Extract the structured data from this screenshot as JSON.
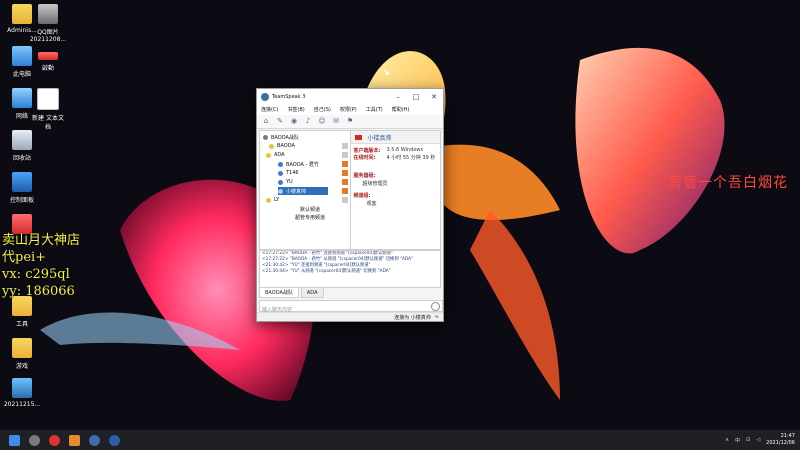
{
  "desktop": {
    "icons": [
      {
        "label": "Adminis...",
        "kind": "folder"
      },
      {
        "label": "QQ图片\n20211208...",
        "kind": "img"
      },
      {
        "label": "此电脑",
        "kind": "pc"
      },
      {
        "label": "啟動",
        "kind": "app"
      },
      {
        "label": "网络",
        "kind": "net"
      },
      {
        "label": "新建 文本文\n档",
        "kind": "doc"
      },
      {
        "label": "回收站",
        "kind": "bin"
      },
      {
        "label": "控制面板",
        "kind": "ctrl"
      },
      {
        "label": "工具",
        "kind": "folder"
      },
      {
        "label": "游戏",
        "kind": "folder"
      },
      {
        "label": "20211215...",
        "kind": "phone"
      }
    ],
    "overlay_lines": [
      "卖山月大神店",
      "代pei+",
      "vx: c295ql",
      "yy: 186066"
    ],
    "side_text": "房管一个吾白烟花"
  },
  "teamspeak": {
    "title": "TeamSpeak 3",
    "menu": [
      "连接(C)",
      "书签(B)",
      "自己(S)",
      "权限(P)",
      "工具(T)",
      "帮助(H)"
    ],
    "tree": {
      "server": "BAODA战队",
      "items": [
        {
          "label": "BAODA",
          "level": 1
        },
        {
          "label": "ADA",
          "level": 1
        },
        {
          "label": "BAODA - 君竹",
          "level": 2
        },
        {
          "label": "T146",
          "level": 2
        },
        {
          "label": "YU",
          "level": 2
        },
        {
          "label": "小楼真帅",
          "level": 2,
          "selected": true
        },
        {
          "label": "LY",
          "level": 1
        },
        {
          "label": "默认频道",
          "level": 2
        },
        {
          "label": "超管专用频道",
          "level": 2
        }
      ]
    },
    "info": {
      "username": "小楼真帅",
      "client_version_label": "客户端版本:",
      "client_version": "3.5.6 Windows",
      "online_label": "在线时间:",
      "online": "4 小时 55 分钟 39 秒",
      "server_group_label": "服务器组:",
      "server_group": "超级管理员",
      "channel_group_label": "频道组:",
      "channel_group": "观客"
    },
    "chat_log": [
      "<17:27:22> \"BAODA - 君竹\" 连接到频道 \"[cspacer04]默认频道\"",
      "<17:27:22> \"BAODA - 君竹\" 从频道 \"[cspacer04]默认频道\" 切换到 \"ADA\"",
      "<21:30:42> \"YU\" 连接到频道 \"[cspacer04]默认频道\"",
      "<21:30:44> \"YU\" 从频道 \"[cspacer04]默认频道\" 切换到 \"ADA\""
    ],
    "chat_tabs": [
      "BAODA战队",
      "ADA"
    ],
    "chat_placeholder": "输入聊天内容",
    "status": "连接为 小楼真帅"
  },
  "taskbar": {
    "time": "21:47",
    "date": "2021/12/06",
    "lang": "中"
  }
}
